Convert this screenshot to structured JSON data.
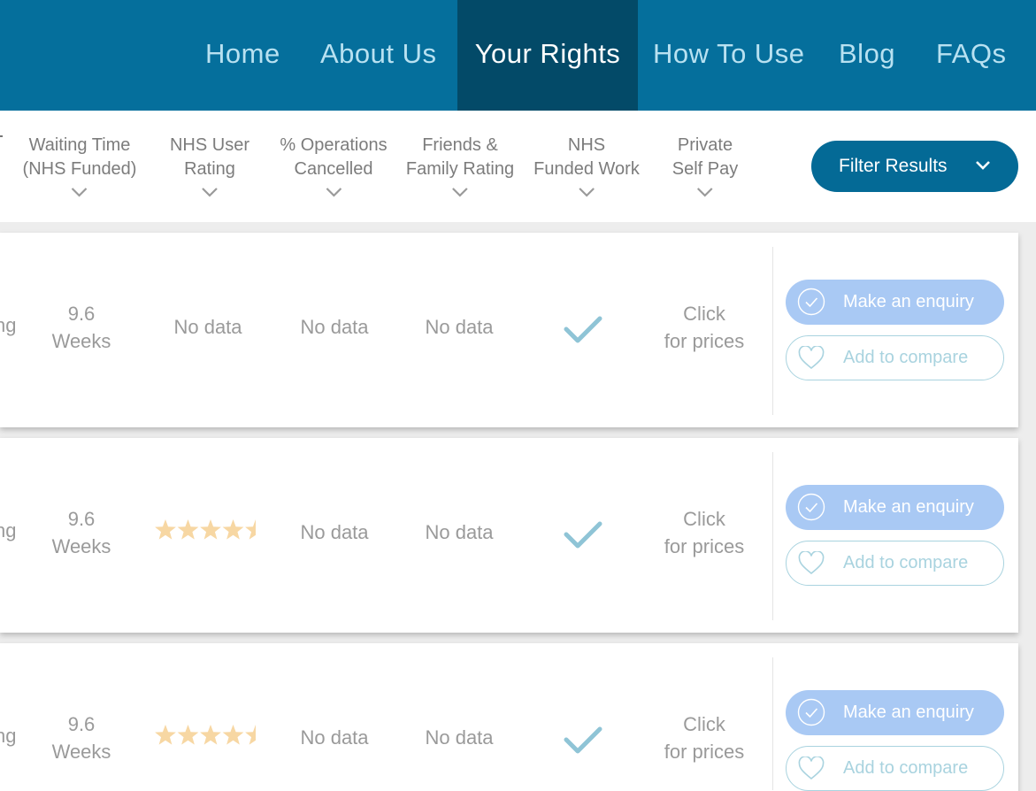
{
  "nav": {
    "items": [
      "Home",
      "About Us",
      "Your Rights",
      "How To Use",
      "Blog",
      "FAQs"
    ],
    "active": "Your Rights"
  },
  "columns": {
    "waiting_time": [
      "Waiting Time",
      "(NHS Funded)"
    ],
    "nhs_user_rating": [
      "NHS User",
      "Rating"
    ],
    "ops_cancelled": [
      "% Operations",
      "Cancelled"
    ],
    "friends_family": [
      "Friends &",
      "Family Rating"
    ],
    "nhs_funded": [
      "NHS",
      "Funded Work"
    ],
    "private_self_pay": [
      "Private",
      "Self Pay"
    ]
  },
  "filter": {
    "label": "Filter Results",
    "icon": "chevron-down-icon"
  },
  "results": [
    {
      "partial_label": "ng",
      "waiting_value": "9.6",
      "waiting_unit": "Weeks",
      "user_rating_text": "No data",
      "user_rating_stars": null,
      "ops_cancelled": "No data",
      "friends_family": "No data",
      "nhs_funded": "check-icon",
      "private_line1": "Click",
      "private_line2": "for prices",
      "enquiry_label": "Make an enquiry",
      "compare_label": "Add to compare"
    },
    {
      "partial_label": "ng",
      "waiting_value": "9.6",
      "waiting_unit": "Weeks",
      "user_rating_text": "",
      "user_rating_stars": 4.5,
      "ops_cancelled": "No data",
      "friends_family": "No data",
      "nhs_funded": "check-icon",
      "private_line1": "Click",
      "private_line2": "for prices",
      "enquiry_label": "Make an enquiry",
      "compare_label": "Add to compare"
    },
    {
      "partial_label": "ng",
      "waiting_value": "9.6",
      "waiting_unit": "Weeks",
      "user_rating_text": "",
      "user_rating_stars": 4.5,
      "ops_cancelled": "No data",
      "friends_family": "No data",
      "nhs_funded": "check-icon",
      "private_line1": "Click",
      "private_line2": "for prices",
      "enquiry_label": "Make an enquiry",
      "compare_label": "Add to compare"
    }
  ],
  "colors": {
    "nav_bg": "#056f9c",
    "nav_active_bg": "#034a68",
    "filter_bg": "#046a96",
    "enquiry_bg": "#a9c9f4",
    "compare_border": "#a9d3df",
    "check": "#8fc4d6",
    "star": "#f7d7a3"
  }
}
